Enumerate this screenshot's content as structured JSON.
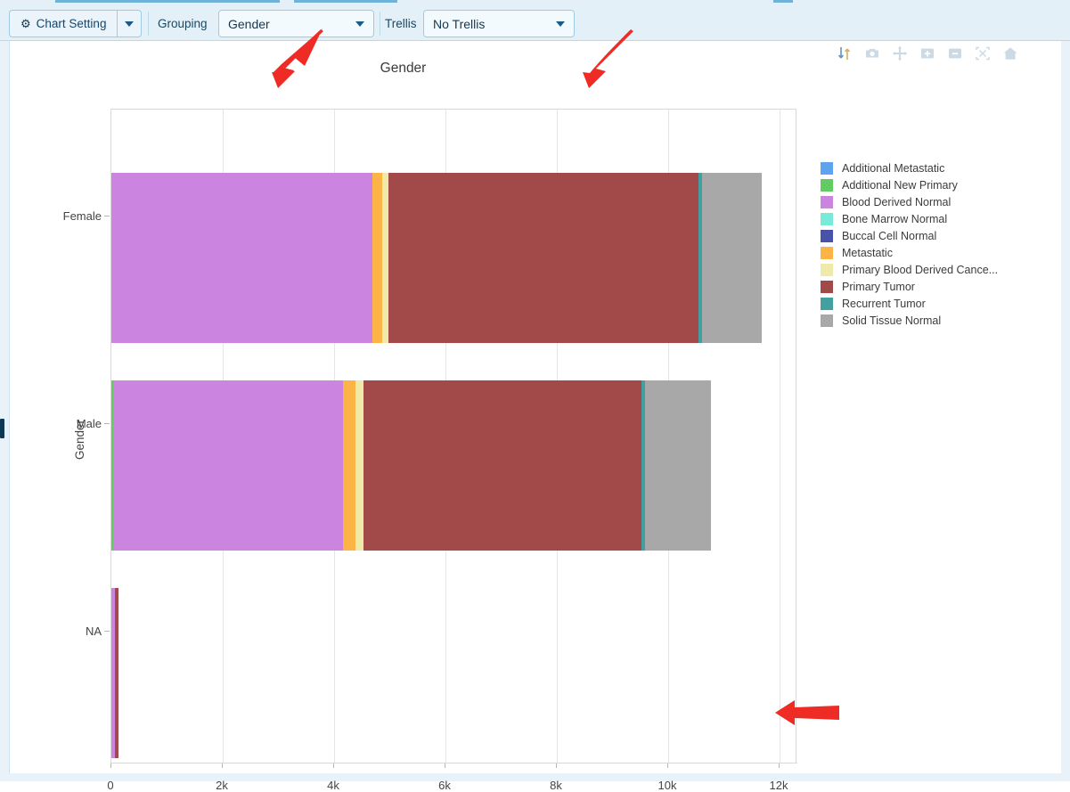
{
  "toolbar": {
    "chart_setting_label": "Chart Setting",
    "gear_icon": "gear-icon",
    "grouping_label": "Grouping",
    "grouping_value": "Gender",
    "trellis_label": "Trellis",
    "trellis_value": "No Trellis"
  },
  "modebar": {
    "icons": [
      "sort-arrows-icon",
      "camera-icon",
      "pan-icon",
      "zoom-in-icon",
      "zoom-out-icon",
      "autoscale-icon",
      "home-icon"
    ]
  },
  "chart_data": {
    "type": "bar",
    "orientation": "horizontal",
    "barmode": "stack",
    "title": "Gender",
    "xlabel": "",
    "ylabel": "Gender",
    "categories": [
      "Female",
      "Male",
      "NA"
    ],
    "xtick_labels": [
      "0",
      "2k",
      "4k",
      "6k",
      "8k",
      "10k",
      "12k"
    ],
    "xtick_values": [
      0,
      2000,
      4000,
      6000,
      8000,
      10000,
      12000
    ],
    "xlim": [
      0,
      12320
    ],
    "grid": true,
    "legend_position": "right",
    "series": [
      {
        "name": "Additional Metastatic",
        "color": "#5fa2f0",
        "values": [
          0,
          0,
          0
        ]
      },
      {
        "name": "Additional New Primary",
        "color": "#62cc63",
        "values": [
          0,
          32,
          0
        ]
      },
      {
        "name": "Blood Derived Normal",
        "color": "#cb84df",
        "values": [
          4690,
          4125,
          64
        ]
      },
      {
        "name": "Bone Marrow Normal",
        "color": "#79ead8",
        "values": [
          0,
          0,
          0
        ]
      },
      {
        "name": "Buccal Cell Normal",
        "color": "#4852a8",
        "values": [
          0,
          0,
          0
        ]
      },
      {
        "name": "Metastatic",
        "color": "#fdb447",
        "values": [
          176,
          224,
          0
        ]
      },
      {
        "name": "Primary Blood Derived Cance...",
        "color": "#f0eaa8",
        "values": [
          112,
          144,
          0
        ]
      },
      {
        "name": "Primary Tumor",
        "color": "#a24a4a",
        "values": [
          5568,
          4992,
          64
        ]
      },
      {
        "name": "Recurrent Tumor",
        "color": "#42a0a0",
        "values": [
          64,
          64,
          0
        ]
      },
      {
        "name": "Solid Tissue Normal",
        "color": "#a8a8a8",
        "values": [
          1072,
          1184,
          0
        ]
      }
    ]
  }
}
